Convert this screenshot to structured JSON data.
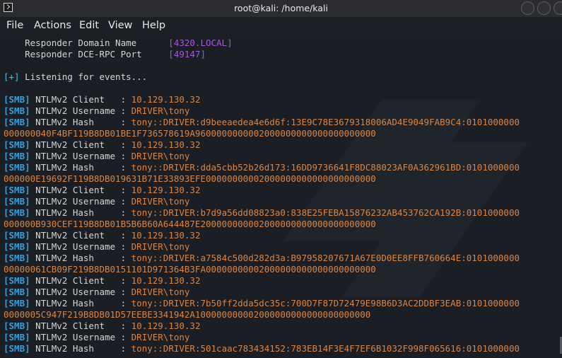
{
  "window": {
    "title": "root@kali: /home/kali"
  },
  "menu": [
    "File",
    "Actions",
    "Edit",
    "View",
    "Help"
  ],
  "terminal": {
    "config": [
      {
        "label": "    Responder Domain Name      ",
        "value": "[4320.LOCAL]"
      },
      {
        "label": "    Responder DCE-RPC Port     ",
        "value": "[49147]"
      }
    ],
    "listening": {
      "plus": "[+]",
      "text": " Listening for events..."
    },
    "smb_tag": "[SMB]",
    "client_label": " NTLMv2 Client   : ",
    "username_label": " NTLMv2 Username : ",
    "hash_label": " NTLMv2 Hash     : ",
    "entries": [
      {
        "client": "10.129.130.32",
        "username": "DRIVER\\tony",
        "hash_1": "tony::DRIVER:d9beeaedea4e6d6f:13E9C78E3679318006AD4E9049FAB9C4:0101000000",
        "hash_2": "000000040F4BF119B8DB01BE1F736578619A9600000000002000000000000000000000"
      },
      {
        "client": "10.129.130.32",
        "username": "DRIVER\\tony",
        "hash_1": "tony::DRIVER:dda5cbb52b26d173:16DD9736641F8DC88023AF0A362961BD:0101000000",
        "hash_2": "000000E19692F119B8DB019631B71E33893EFE00000000002000000000000000000000"
      },
      {
        "client": "10.129.130.32",
        "username": "DRIVER\\tony",
        "hash_1": "tony::DRIVER:b7d9a56dd08823a0:838E25FEBA15876232AB453762CA192B:0101000000",
        "hash_2": "000000B930CEF119B8DB01B5B6B60A644487E200000000002000000000000000000000"
      },
      {
        "client": "10.129.130.32",
        "username": "DRIVER\\tony",
        "hash_1": "tony::DRIVER:a7584c500d282d3a:B97958207671A67E0D0EE8FFB760664E:0101000000",
        "hash_2": "00000061CB09F219B8DB0151101D971364B3FA00000000002000000000000000000000"
      },
      {
        "client": "10.129.130.32",
        "username": "DRIVER\\tony",
        "hash_1": "tony::DRIVER:7b50ff2dda5dc35c:700D7F87D72479E98B6D3AC2DDBF3EAB:0101000000",
        "hash_2": "0000005C947F219B8DB01D57EEBE3341942A100000000002000000000000000000000"
      }
    ],
    "last": {
      "client": "10.129.130.32",
      "username": "DRIVER\\tony",
      "hash_1": "tony::DRIVER:501caac783434152:783EB14F3E4F7EF6B1032F998F065616:0101000000"
    }
  }
}
